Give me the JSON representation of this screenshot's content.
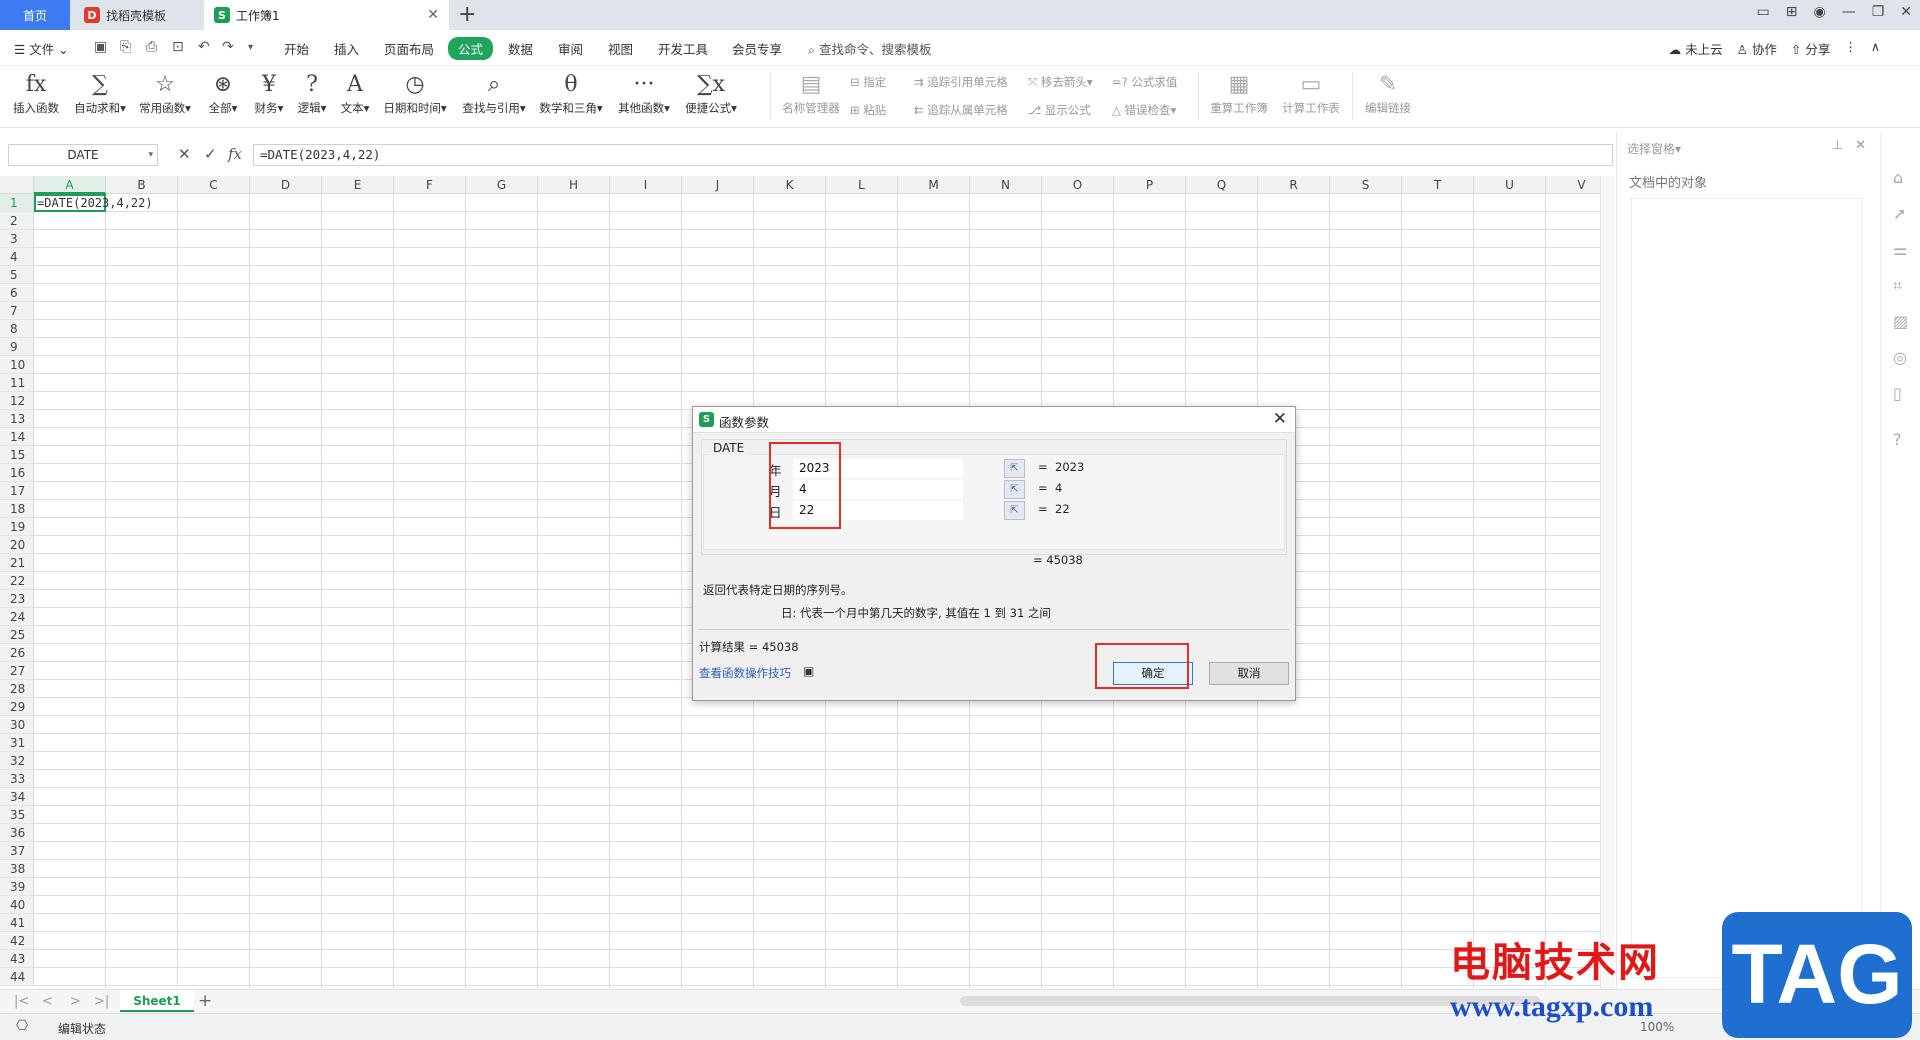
{
  "tabs": {
    "home": "首页",
    "template": "找稻壳模板",
    "workbook": "工作簿1"
  },
  "menu": {
    "file": "文件",
    "items": [
      "开始",
      "插入",
      "页面布局",
      "公式",
      "数据",
      "审阅",
      "视图",
      "开发工具",
      "会员专享"
    ],
    "search": "查找命令、搜索模板",
    "cloud": "未上云",
    "collab": "协作",
    "share": "分享"
  },
  "ribbon": {
    "main": [
      {
        "label": "插入函数",
        "icon": "fx-icon",
        "glyph": "fx"
      },
      {
        "label": "自动求和▾",
        "icon": "sum-icon",
        "glyph": "∑"
      },
      {
        "label": "常用函数▾",
        "icon": "star-icon",
        "glyph": "☆"
      },
      {
        "label": "全部▾",
        "icon": "all-icon",
        "glyph": "⊛"
      },
      {
        "label": "财务▾",
        "icon": "finance-icon",
        "glyph": "¥"
      },
      {
        "label": "逻辑▾",
        "icon": "logic-icon",
        "glyph": "?"
      },
      {
        "label": "文本▾",
        "icon": "text-icon",
        "glyph": "A"
      },
      {
        "label": "日期和时间▾",
        "icon": "clock-icon",
        "glyph": "◷"
      },
      {
        "label": "查找与引用▾",
        "icon": "lookup-icon",
        "glyph": "⌕"
      },
      {
        "label": "数学和三角▾",
        "icon": "math-icon",
        "glyph": "θ"
      },
      {
        "label": "其他函数▾",
        "icon": "more-icon",
        "glyph": "···"
      },
      {
        "label": "便捷公式▾",
        "icon": "quick-formula-icon",
        "glyph": "∑x"
      }
    ],
    "name_manager": "名称管理器",
    "define": "指定",
    "paste": "粘贴",
    "trace_precedents": "追踪引用单元格",
    "trace_dependents": "追踪从属单元格",
    "remove_arrows": "移去箭头▾",
    "show_formula": "显示公式",
    "eval_formula": "公式求值",
    "error_check": "错误检查▾",
    "recalc_book": "重算工作簿",
    "calc_sheet": "计算工作表",
    "edit_links": "编辑链接"
  },
  "formula_bar": {
    "name_box": "DATE",
    "formula": "=DATE(2023,4,22)",
    "fx": "fx"
  },
  "sheet": {
    "columns": [
      "A",
      "B",
      "C",
      "D",
      "E",
      "F",
      "G",
      "H",
      "I",
      "J",
      "K",
      "L",
      "M",
      "N",
      "O",
      "P",
      "Q",
      "R",
      "S",
      "T",
      "U",
      "V"
    ],
    "row_count": 44,
    "a1": "=DATE(2023,4,22)"
  },
  "dialog": {
    "title": "函数参数",
    "function": "DATE",
    "args": [
      {
        "label": "年",
        "value": "2023",
        "result": "2023"
      },
      {
        "label": "月",
        "value": "4",
        "result": "4"
      },
      {
        "label": "日",
        "value": "22",
        "result": "22"
      }
    ],
    "eq": "=",
    "total": "=  45038",
    "description": "返回代表特定日期的序列号。",
    "arg_help": "日:  代表一个月中第几天的数字, 其值在 1 到 31 之间",
    "calc_result": "计算结果  =  45038",
    "help_link": "查看函数操作技巧",
    "ok": "确定",
    "cancel": "取消"
  },
  "pane": {
    "title": "选择窗格▾",
    "subtitle": "文档中的对象"
  },
  "sheet_tab": "Sheet1",
  "status": {
    "mode": "编辑状态",
    "zoom": "100%"
  },
  "watermark": {
    "text": "电脑技术网",
    "url": "www.tagxp.com",
    "tag": "TAG"
  },
  "colors": {
    "accent": "#1e9d56",
    "highlight": "#e0302b",
    "home_tab": "#3d7cf0"
  }
}
